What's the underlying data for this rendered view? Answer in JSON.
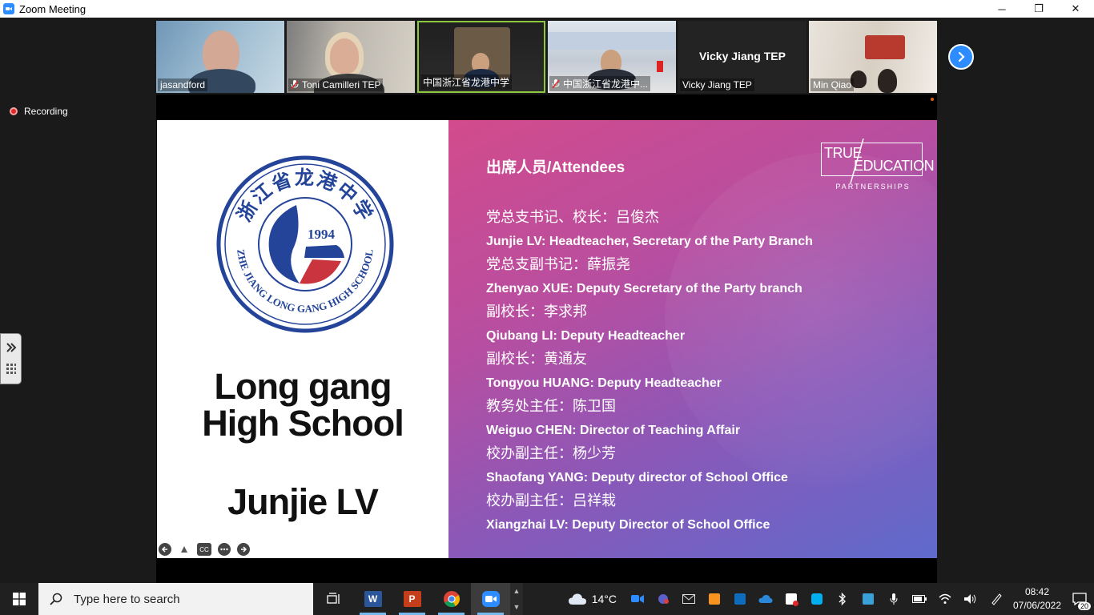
{
  "window": {
    "title": "Zoom Meeting",
    "minimize": "─",
    "restore": "❐",
    "close": "✕"
  },
  "participants": [
    {
      "name": "jasandford",
      "muted": false
    },
    {
      "name": "Toni Camilleri TEP",
      "muted": true
    },
    {
      "name": "中国浙江省龙港中学",
      "muted": false
    },
    {
      "name": "中国浙江省龙港中...",
      "muted": true
    },
    {
      "name": "Vicky Jiang TEP",
      "muted": false,
      "display_name": "Vicky Jiang TEP"
    },
    {
      "name": "Min Qiao",
      "muted": false
    }
  ],
  "recording": {
    "label": "Recording"
  },
  "slide": {
    "logo": {
      "year": "1994",
      "cn_text": "浙江省龙港中学",
      "en_text": "ZHE JIANG LONG GANG HIGH SCHOOL"
    },
    "school_line1": "Long gang",
    "school_line2": "High School",
    "person": "Junjie LV",
    "attendees_title": "出席人员/Attendees",
    "attendees": [
      "党总支书记、校长：吕俊杰",
      "Junjie LV: Headteacher, Secretary of the Party Branch",
      "党总支副书记：薛振尧",
      "Zhenyao XUE: Deputy Secretary of the Party branch",
      "副校长：李求邦",
      "Qiubang LI: Deputy Headteacher",
      "副校长：黄通友",
      "Tongyou HUANG: Deputy Headteacher",
      "教务处主任：陈卫国",
      "Weiguo CHEN: Director of Teaching Affair",
      "校办副主任：杨少芳",
      "Shaofang YANG: Deputy director of School Office",
      "校办副主任：吕祥栽",
      "Xiangzhai LV: Deputy Director of School Office"
    ],
    "brand": {
      "line1": "TRUE",
      "line2": "EDUCATION",
      "sub": "PARTNERSHIPS"
    },
    "controls": {
      "cc": "CC"
    }
  },
  "taskbar": {
    "search_placeholder": "Type here to search",
    "weather_temp": "14°C",
    "time": "08:42",
    "date": "07/06/2022",
    "notifications": "20",
    "apps": {
      "word": "W",
      "powerpoint": "P"
    }
  },
  "colors": {
    "zoom_blue": "#2d8cff",
    "slide_pink": "#d24b8c",
    "slide_blue": "#5e6bcc",
    "logo_navy": "#24449a",
    "logo_red": "#c9343e"
  }
}
